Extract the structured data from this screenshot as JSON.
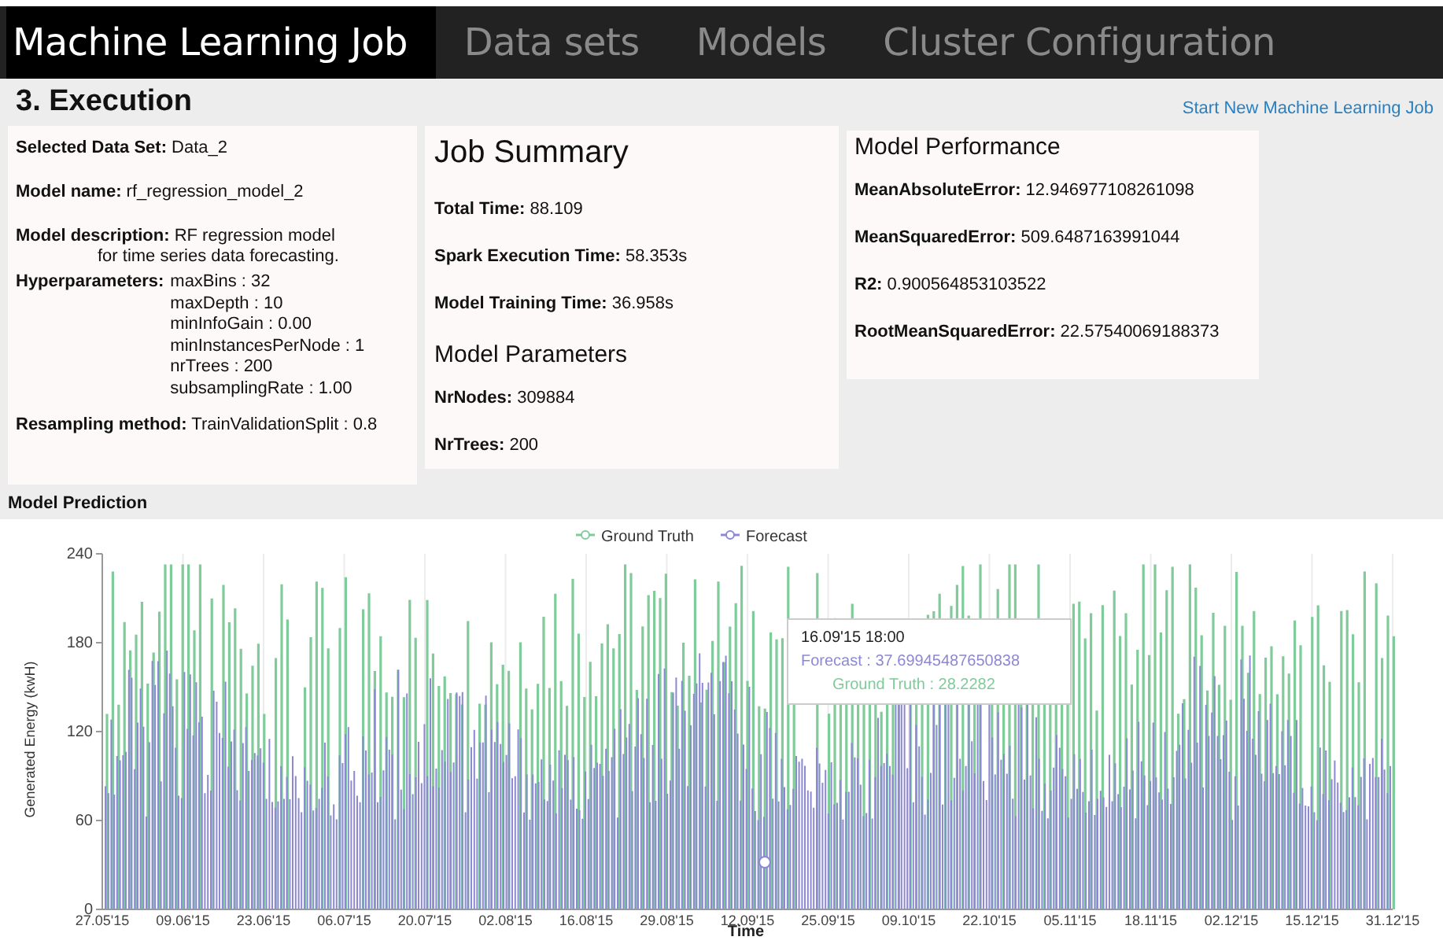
{
  "nav_tabs": [
    {
      "label": "Machine Learning Job",
      "selected": true
    },
    {
      "label": "Data sets",
      "selected": false
    },
    {
      "label": "Models",
      "selected": false
    },
    {
      "label": "Cluster Configuration",
      "selected": false
    }
  ],
  "heading": "3. Execution",
  "new_job_link": "Start New Machine Learning Job",
  "job_details": [
    {
      "kind": "inline",
      "label": "Selected Data Set:",
      "lines": [
        "Data_2"
      ]
    },
    {
      "kind": "inline",
      "label": "Model name:",
      "lines": [
        "rf_regression_model_2"
      ]
    },
    {
      "kind": "inline",
      "label": "Model description:",
      "lines": [
        "RF regression model",
        "for time series data forecasting."
      ]
    },
    {
      "kind": "list",
      "label": "Hyperparameters:",
      "lines": [
        "maxBins : 32",
        "maxDepth : 10",
        "minInfoGain : 0.00",
        "minInstancesPerNode : 1",
        "nrTrees : 200",
        "subsamplingRate : 1.00"
      ]
    },
    {
      "kind": "inline",
      "label": "Resampling method:",
      "lines": [
        "TrainValidationSplit : 0.8"
      ]
    }
  ],
  "job_summary": {
    "title": "Job Summary",
    "items": [
      {
        "label": "Total Time:",
        "value": "88.109"
      },
      {
        "label": "Spark Execution Time:",
        "value": "58.353s"
      },
      {
        "label": "Model Training Time:",
        "value": "36.958s"
      }
    ]
  },
  "model_parameters": {
    "title": "Model Parameters",
    "items": [
      {
        "label": "NrNodes:",
        "value": "309884"
      },
      {
        "label": "NrTrees:",
        "value": "200"
      }
    ]
  },
  "model_performance": {
    "title": "Model Performance",
    "items": [
      {
        "label": "MeanAbsoluteError:",
        "value": "12.946977108261098"
      },
      {
        "label": "MeanSquaredError:",
        "value": "509.6487163991044"
      },
      {
        "label": "R2:",
        "value": "0.900564853103522"
      },
      {
        "label": "RootMeanSquaredError:",
        "value": "22.57540069188373"
      }
    ]
  },
  "prediction": {
    "title": "Model Prediction",
    "legend": [
      {
        "label": "Ground Truth",
        "color": "#7fcb9a"
      },
      {
        "label": "Forecast",
        "color": "#8c88d4"
      }
    ],
    "ylabel": "Generated Energy (kwH)",
    "xlabel": "Time",
    "yticks": [
      "240",
      "180",
      "120",
      "60",
      "0"
    ],
    "xticks": [
      "27.05'15",
      "09.06'15",
      "23.06'15",
      "06.07'15",
      "20.07'15",
      "02.08'15",
      "16.08'15",
      "29.08'15",
      "12.09'15",
      "25.09'15",
      "09.10'15",
      "22.10'15",
      "05.11'15",
      "18.11'15",
      "02.12'15",
      "15.12'15",
      "31.12'15"
    ],
    "tooltip": {
      "title": "16.09'15 18:00",
      "lines": [
        "Forecast : 37.69945487650838",
        "Ground Truth : 28.2282"
      ]
    }
  }
}
